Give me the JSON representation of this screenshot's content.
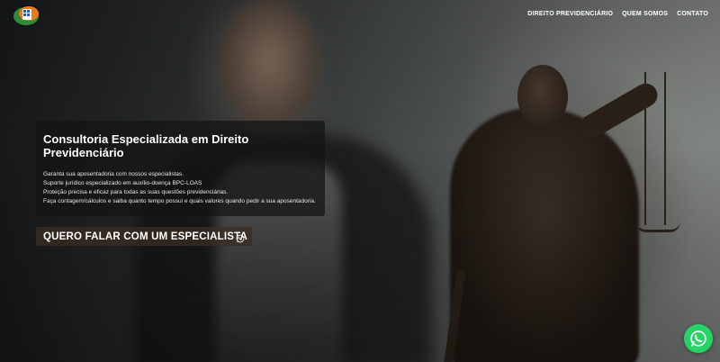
{
  "nav": {
    "items": [
      {
        "label": "DIREITO PREVIDENCIÁRIO"
      },
      {
        "label": "QUEM SOMOS"
      },
      {
        "label": "CONTATO"
      }
    ]
  },
  "hero": {
    "title": "Consultoria Especializada em Direito Previdenciário",
    "lines": [
      "Garanta sua aposentadoria com nossos especialistas.",
      "Suporte jurídico especializado em auxílio-doença BPC-LOAS",
      "Proteção precisa e eficaz para todas as suas questões previdenciárias.",
      "Faça contagem/cálculos e saiba quanto tempo possui e quais valores quando pedir a sua aposentadoria."
    ],
    "cta_label": "QUERO FALAR COM UM ESPECIALISTA"
  },
  "icons": {
    "logo": "logo-icon",
    "cta": "whatsapp-icon",
    "floating": "whatsapp-icon"
  },
  "colors": {
    "whatsapp": "#25d366",
    "logo_green": "#2e8b3a",
    "logo_orange": "#f07a1a"
  }
}
